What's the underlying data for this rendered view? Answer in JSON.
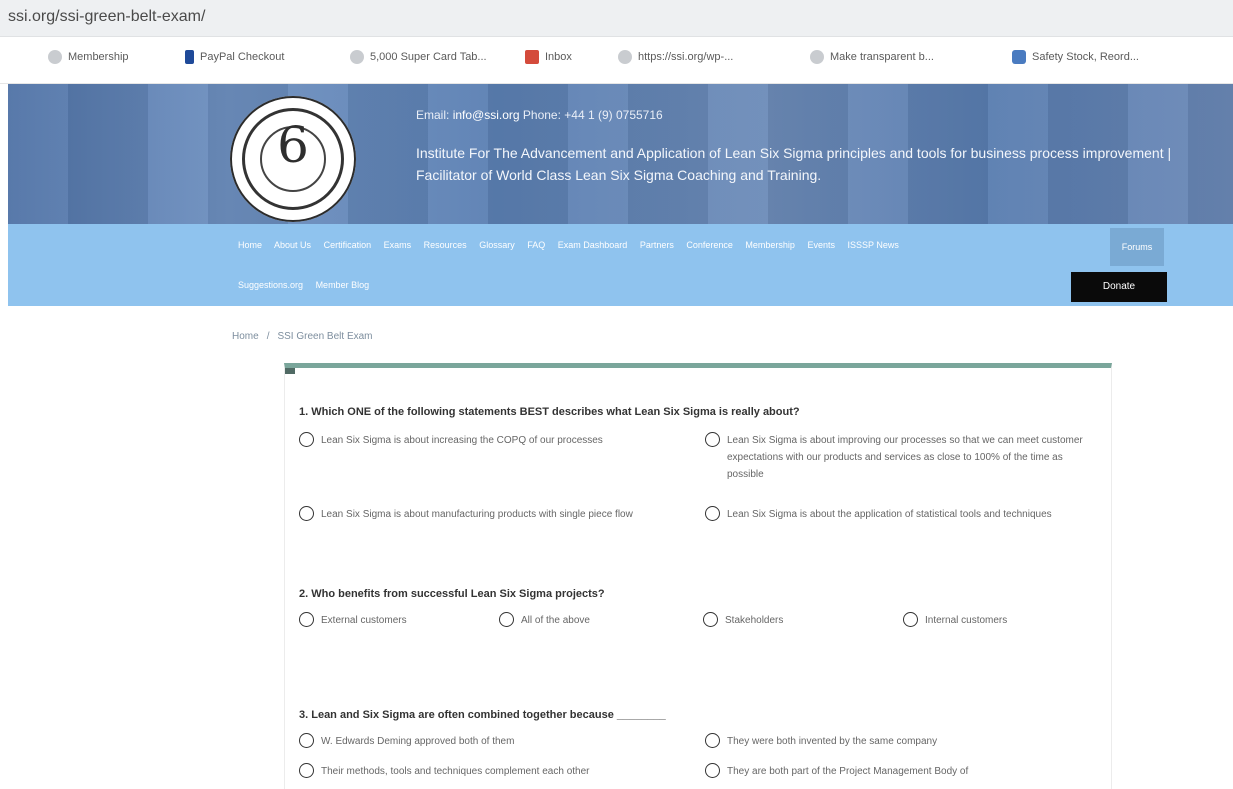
{
  "browser": {
    "url": "ssi.org/ssi-green-belt-exam/",
    "bookmarks": [
      "Membership",
      "PayPal Checkout",
      "5,000 Super Card Tab...",
      "Inbox",
      "https://ssi.org/wp-...",
      "Make transparent b...",
      "Safety Stock, Reord..."
    ]
  },
  "header": {
    "contact_label_email": "Email",
    "email": "info@ssi.org",
    "contact_label_phone": "Phone",
    "phone": "+44 1 (9) 0755716",
    "tagline": "Institute For The Advancement and Application of Lean Six Sigma principles and tools for business process improvement | Facilitator of World Class Lean Six Sigma Coaching and Training.",
    "logo_glyph": "6"
  },
  "nav": {
    "row1": [
      "Home",
      "About Us",
      "Certification",
      "Exams",
      "Resources",
      "Glossary",
      "FAQ",
      "Exam Dashboard",
      "Partners",
      "Conference",
      "Membership",
      "Events",
      "ISSSP News"
    ],
    "active": "Forums",
    "row2": [
      "Suggestions.org",
      "Member Blog"
    ],
    "donate": "Donate"
  },
  "breadcrumb": {
    "home": "Home",
    "current": "SSI Green Belt Exam"
  },
  "quiz": {
    "q1": {
      "text": "1. Which ONE of the following statements BEST describes what Lean Six Sigma is really about?",
      "options": [
        "Lean Six Sigma is about increasing the COPQ of our processes",
        "Lean Six Sigma is about improving our processes so that we can meet customer expectations with our products and services as close to 100% of the time as possible",
        "Lean Six Sigma is about manufacturing products with single piece flow",
        "Lean Six Sigma is about the application of statistical tools and techniques"
      ]
    },
    "q2": {
      "text": "2. Who benefits from successful Lean Six Sigma projects?",
      "options": [
        "External customers",
        "All of the above",
        "Stakeholders",
        "Internal customers"
      ]
    },
    "q3": {
      "text": "3. Lean and Six Sigma are often combined together because ________",
      "options": [
        "W. Edwards Deming approved both of them",
        "They were both invented by the same company",
        "Their methods, tools and techniques complement each other",
        "They are both part of the Project Management Body of"
      ]
    }
  }
}
